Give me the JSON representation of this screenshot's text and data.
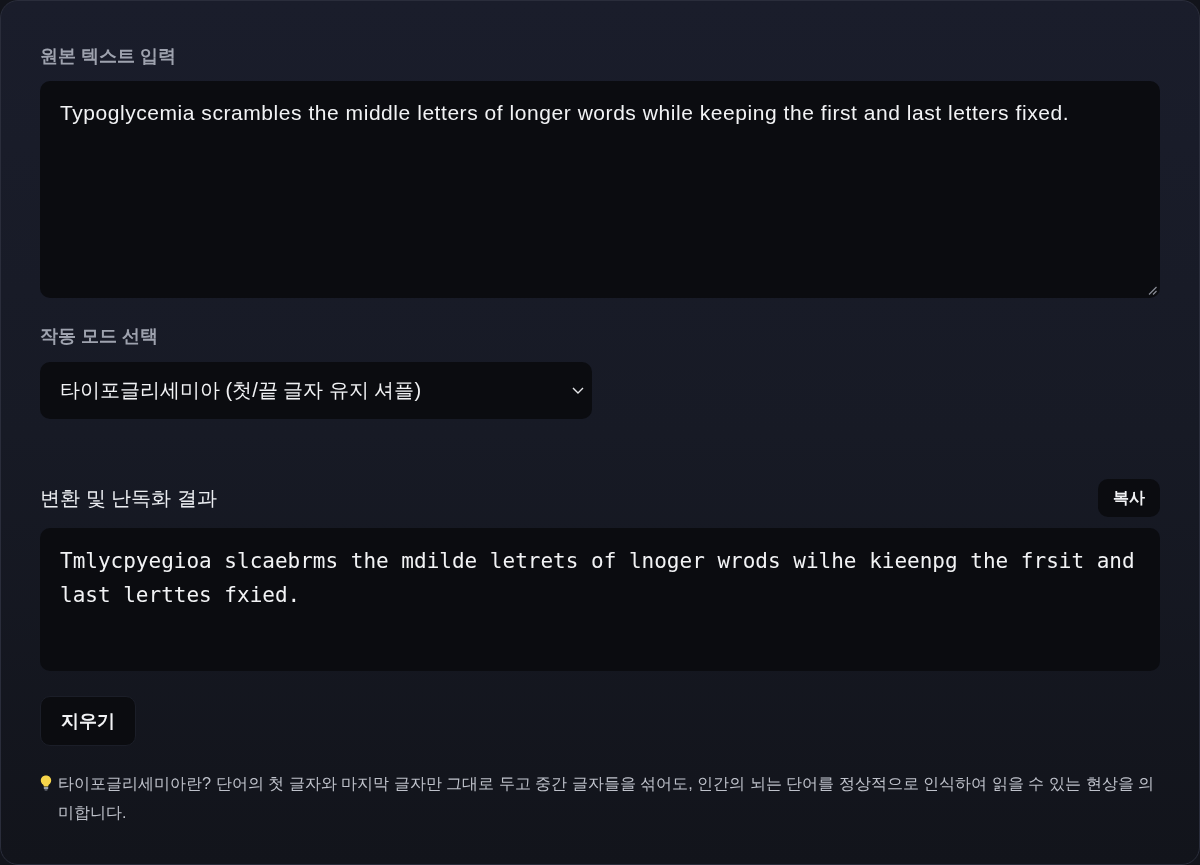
{
  "input": {
    "label": "원본 텍스트 입력",
    "value": "Typoglycemia scrambles the middle letters of longer words while keeping the first and last letters fixed."
  },
  "mode": {
    "label": "작동 모드 선택",
    "value": "타이포글리세미아 (첫/끝 글자 유지 셔플)"
  },
  "result": {
    "title": "변환 및 난독화 결과",
    "copy_button": "복사",
    "text": "Tmlycpyegioa slcaebrms the mdilde letrets of lnoger wrods wilhe kieenpg the frsit and last lerttes fxied."
  },
  "clear_button": "지우기",
  "note": "타이포글리세미아란? 단어의 첫 글자와 마지막 글자만 그대로 두고 중간 글자들을 섞어도, 인간의 뇌는 단어를 정상적으로 인식하여 읽을 수 있는 현상을 의미합니다."
}
